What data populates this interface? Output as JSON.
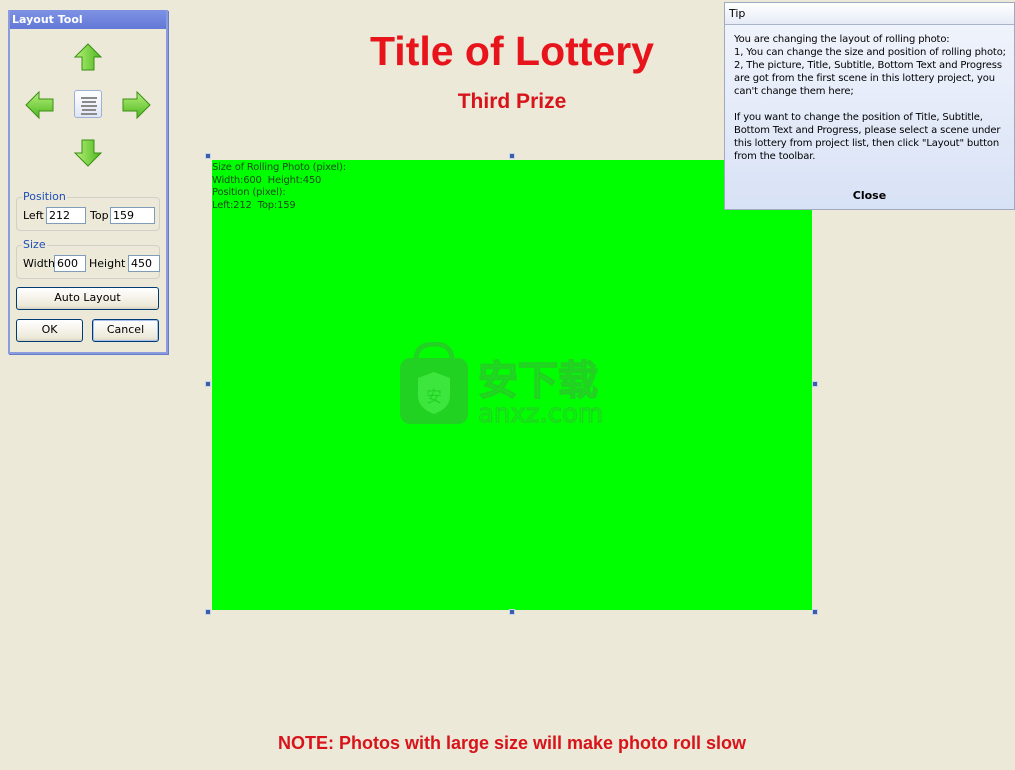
{
  "page": {
    "title": "Title of Lottery",
    "subtitle": "Third Prize",
    "bottom_text": "NOTE: Photos with large size will make photo roll slow",
    "colors": {
      "background": "#ece9d8",
      "title_red": "#e8141b",
      "photo_placeholder": "#00ff00",
      "handle_blue": "#3a5ea8"
    }
  },
  "photo": {
    "info_lines": [
      "Size of Rolling Photo (pixel):",
      "Width:600  Height:450",
      "Position (pixel):",
      "Left:212  Top:159"
    ],
    "watermark_text": "安下载",
    "watermark_domain": "anxz.com"
  },
  "layout_tool": {
    "title": "Layout Tool",
    "icons": {
      "up": "arrow-up-icon",
      "down": "arrow-down-icon",
      "left": "arrow-left-icon",
      "right": "arrow-right-icon",
      "center": "align-center-icon"
    },
    "position": {
      "legend": "Position",
      "left_label": "Left",
      "left_value": "212",
      "top_label": "Top",
      "top_value": "159"
    },
    "size": {
      "legend": "Size",
      "width_label": "Width",
      "width_value": "600",
      "height_label": "Height",
      "height_value": "450"
    },
    "auto_layout_label": "Auto Layout",
    "ok_label": "OK",
    "cancel_label": "Cancel"
  },
  "tip": {
    "title": "Tip",
    "paragraphs": [
      "You are changing the layout of rolling photo:\n1, You can change the size and position of rolling photo;\n2, The picture, Title, Subtitle, Bottom Text and Progress are got from the first scene in this lottery project, you can't change them here;",
      "If you want to change the position of Title, Subtitle, Bottom Text and Progress, please select a scene under this lottery from project list, then click \"Layout\" button from the toolbar."
    ],
    "close_label": "Close"
  }
}
